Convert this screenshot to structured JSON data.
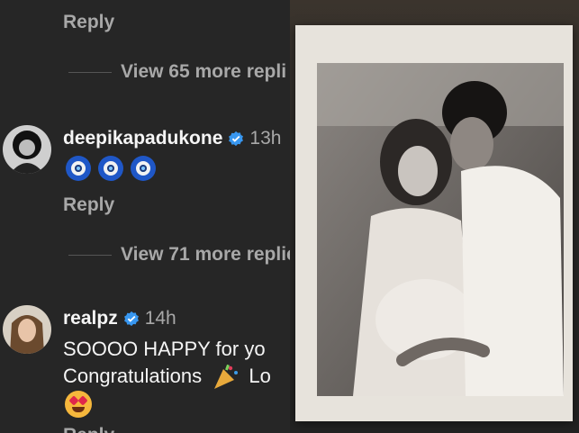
{
  "comments_panel": {
    "top_reply": "Reply",
    "view_more_1": "View 65 more repli",
    "comment_1": {
      "username": "deepikapadukone",
      "time": "13h",
      "reply": "Reply"
    },
    "view_more_2": "View 71 more replie",
    "comment_2": {
      "username": "realpz",
      "time": "14h",
      "line1": "SOOOO HAPPY for yo",
      "line2_start": "Congratulations",
      "line2_end": "Lo"
    },
    "bottom_reply": "Reply"
  },
  "photo_panel": {
    "description": ""
  },
  "colors": {
    "bg": "#262626",
    "muted": "#a8a8a8",
    "verified": "#3897f0"
  },
  "icons": [
    "verified-badge-icon",
    "evil-eye-icon",
    "party-popper-icon",
    "heart-eyes-icon"
  ]
}
